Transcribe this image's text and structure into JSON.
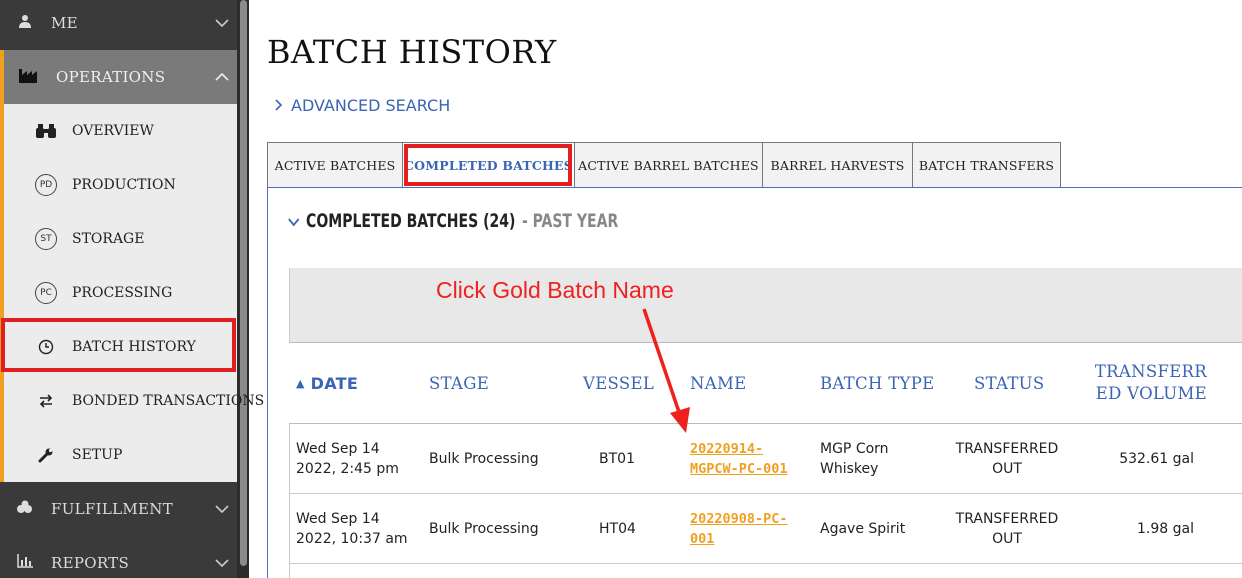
{
  "sidebar": {
    "me_label": "ME",
    "operations_label": "OPERATIONS",
    "items": [
      {
        "label": "OVERVIEW",
        "icon": "binoculars-icon"
      },
      {
        "label": "PRODUCTION",
        "icon": "pd-circle-icon",
        "abbr": "PD"
      },
      {
        "label": "STORAGE",
        "icon": "st-circle-icon",
        "abbr": "ST"
      },
      {
        "label": "PROCESSING",
        "icon": "pc-circle-icon",
        "abbr": "PC"
      },
      {
        "label": "BATCH HISTORY",
        "icon": "clock-icon"
      },
      {
        "label": "BONDED TRANSACTIONS",
        "icon": "transfer-arrows-icon"
      },
      {
        "label": "SETUP",
        "icon": "wrench-icon"
      }
    ],
    "fulfillment_label": "FULFILLMENT",
    "reports_label": "REPORTS"
  },
  "page": {
    "title": "BATCH HISTORY",
    "advanced_search": "ADVANCED SEARCH"
  },
  "tabs": [
    "ACTIVE BATCHES",
    "COMPLETED BATCHES",
    "ACTIVE BARREL BATCHES",
    "BARREL HARVESTS",
    "BATCH TRANSFERS"
  ],
  "active_tab": "COMPLETED BATCHES",
  "section": {
    "title": "COMPLETED BATCHES (24)",
    "subtitle": "- PAST YEAR"
  },
  "annotation": "Click Gold Batch Name",
  "table": {
    "headers": {
      "date": "DATE",
      "stage": "STAGE",
      "vessel": "VESSEL",
      "name": "NAME",
      "batch_type": "BATCH TYPE",
      "status": "STATUS",
      "transferred_volume_1": "TRANSFERR",
      "transferred_volume_2": "ED VOLUME"
    },
    "rows": [
      {
        "date_1": "Wed Sep 14",
        "date_2": "2022, 2:45 pm",
        "stage": "Bulk Processing",
        "vessel": "BT01",
        "name_1": "20220914-",
        "name_2": "MGPCW-PC-001",
        "type_1": "MGP Corn",
        "type_2": "Whiskey",
        "status_1": "TRANSFERRED",
        "status_2": "OUT",
        "volume": "532.61 gal"
      },
      {
        "date_1": "Wed Sep 14",
        "date_2": "2022, 10:37 am",
        "stage": "Bulk Processing",
        "vessel": "HT04",
        "name_1": "20220908-PC-",
        "name_2": "001",
        "type_1": "Agave Spirit",
        "type_2": "",
        "status_1": "TRANSFERRED",
        "status_2": "OUT",
        "volume": "1.98 gal"
      }
    ]
  },
  "colors": {
    "accent_blue": "#3a64b4",
    "gold_link": "#f0a020",
    "highlight_red": "#e02020",
    "sidebar_dark": "#3a3a3a"
  }
}
